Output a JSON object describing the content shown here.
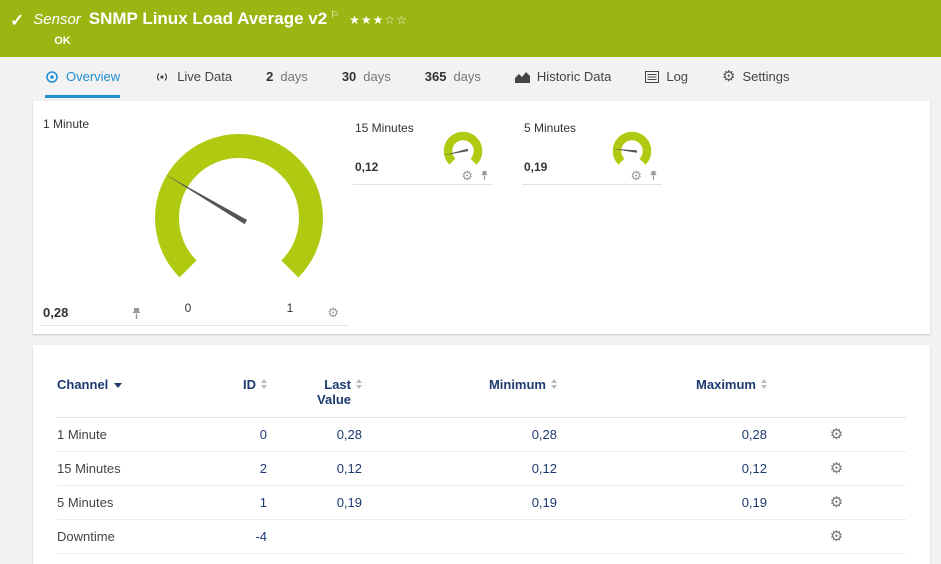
{
  "colors": {
    "header_green": "#9bb512",
    "gauge_green": "#afca10",
    "accent_blue": "#1e8fd5",
    "navy": "#1d3a70"
  },
  "icons": {
    "check": "✓",
    "flag": "⚐",
    "gear": "⚙"
  },
  "header": {
    "kind_label": "Sensor",
    "title": "SNMP Linux Load Average v2",
    "stars_filled": "★★★",
    "stars_empty": "☆☆",
    "status": "OK"
  },
  "tabs": [
    {
      "label": "Overview",
      "active": true
    },
    {
      "label": "Live Data"
    },
    {
      "num": "2",
      "label": "days"
    },
    {
      "num": "30",
      "label": "days"
    },
    {
      "num": "365",
      "label": "days"
    },
    {
      "label": "Historic Data"
    },
    {
      "label": "Log"
    },
    {
      "label": "Settings"
    }
  ],
  "gauges": {
    "large": {
      "name": "1 Minute",
      "value": "0,28",
      "value_num": 0.28,
      "scale_min_label": "0",
      "scale_max_label": "1"
    },
    "small": [
      {
        "name": "15 Minutes",
        "value": "0,12",
        "value_num": 0.12
      },
      {
        "name": "5 Minutes",
        "value": "0,19",
        "value_num": 0.19
      }
    ]
  },
  "table": {
    "columns": [
      {
        "label": "Channel"
      },
      {
        "label": "ID"
      },
      {
        "label": "Last Value"
      },
      {
        "label": "Minimum"
      },
      {
        "label": "Maximum"
      }
    ],
    "rows": [
      {
        "channel": "1 Minute",
        "id": "0",
        "last_value": "0,28",
        "minimum": "0,28",
        "maximum": "0,28"
      },
      {
        "channel": "15 Minutes",
        "id": "2",
        "last_value": "0,12",
        "minimum": "0,12",
        "maximum": "0,12"
      },
      {
        "channel": "5 Minutes",
        "id": "1",
        "last_value": "0,19",
        "minimum": "0,19",
        "maximum": "0,19"
      },
      {
        "channel": "Downtime",
        "id": "-4",
        "last_value": "",
        "minimum": "",
        "maximum": ""
      }
    ]
  }
}
